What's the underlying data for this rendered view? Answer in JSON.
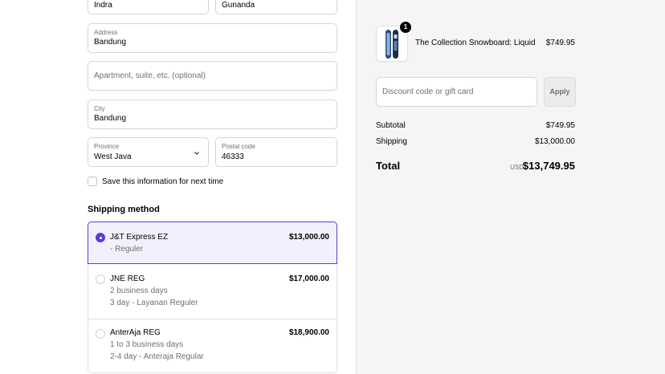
{
  "form": {
    "first_name_value": "Indra",
    "last_name_value": "Gunanda",
    "address": {
      "label": "Address",
      "value": "Bandung"
    },
    "apartment": {
      "placeholder": "Apartment, suite, etc. (optional)"
    },
    "city": {
      "label": "City",
      "value": "Bandung"
    },
    "province": {
      "label": "Province",
      "value": "West Java"
    },
    "postal_code": {
      "label": "Postal code",
      "value": "46333"
    },
    "save_info_label": "Save this information for next time"
  },
  "shipping": {
    "title": "Shipping method",
    "options": [
      {
        "name": "J&T Express EZ",
        "details": [
          "- Reguler"
        ],
        "price": "$13,000.00",
        "selected": true
      },
      {
        "name": "JNE REG",
        "details": [
          "2 business days",
          "3 day - Layanan Reguler"
        ],
        "price": "$17,000.00",
        "selected": false
      },
      {
        "name": "AnterAja REG",
        "details": [
          "1 to 3 business days",
          "2-4 day - Anteraja Regular"
        ],
        "price": "$18,900.00",
        "selected": false
      }
    ]
  },
  "summary": {
    "product": {
      "name": "The Collection Snowboard: Liquid",
      "price": "$749.95",
      "quantity": "1"
    },
    "discount_placeholder": "Discount code or gift card",
    "apply_label": "Apply",
    "subtotal_label": "Subtotal",
    "subtotal_value": "$749.95",
    "shipping_label": "Shipping",
    "shipping_value": "$13,000.00",
    "total_label": "Total",
    "total_currency": "USD",
    "total_value": "$13,749.95"
  },
  "colors": {
    "accent": "#5b3ae0",
    "sidebar_bg": "#f5f5f5"
  }
}
